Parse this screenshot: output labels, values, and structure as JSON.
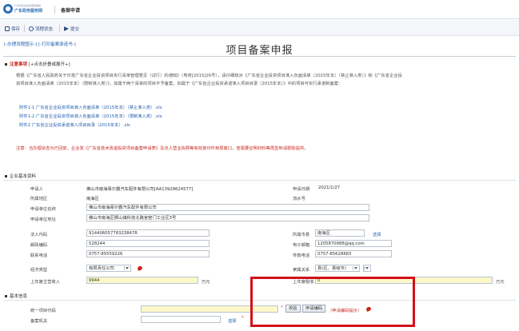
{
  "header": {
    "logo_small": "广东省企业投资项目备案",
    "logo_text": "广东政务服务网",
    "title": "备案申请"
  },
  "toolbar": {
    "save": "保存",
    "process_status": "流程状态",
    "submit": "提交"
  },
  "breadlinks": "[-办理流程图示-] [-打印备案承诺书-]",
  "page_title": "项目备案申报",
  "notice": {
    "heading": "注意事项",
    "fold": "[+点击折叠或展开+]",
    "para1": "根据《广东省人民政府关于印发广东省企业投资项目实行清单管理意见（试行）的通知》（粤府[2015]26号），请仔细核对《广东省企业投资项目准入负面清单（2015年本）（禁止准入类）》和《广东省企业投",
    "para2": "资项目准入负面清单（2015年本）（限制准入类）》，如属于两个清单的项目不予备案，如属于《广东省企业投资承诺准入项目目录（2015年本）》中的项目可实行承诺制备案：",
    "attachments": [
      "附件1-1 广东省企业投资项目准入负面清单（2015年本）（禁止准入类）.xls",
      "附件1-2 广东省企业投资项目准入负面清单（2015年本）（限制准入类）.xls",
      "附件2 广东省企业投资承诺准入项目目录（2015年本）.xls"
    ],
    "warning": "注意：当办理状态为已回复、企业发《广东省技术改造投资项目备案申请表》及法人营业执照等有效复印件到局窗口，若需要证明材料等再签到请帮助提供。"
  },
  "company_section": {
    "heading": "企业基本资料",
    "applicant_label": "申请人",
    "applicant_value": "佛山市南海易尔霸汽车配件有限公司[AA13928624577]",
    "apply_date_label": "申请日期",
    "apply_date_value": "2021/1/27",
    "region_label": "所属地区",
    "region_value": "南海区",
    "serial_label": "流水号",
    "serial_value": "",
    "unit_name_label": "申请单位名称",
    "unit_name_value": "佛山市南海易尔霸汽车配件有限公司",
    "address_label": "申请单位地址",
    "address_value": "佛山市南海区狮山镇科技北路官窑门工业区3号",
    "legal_code_label": "法人代码",
    "legal_code_value": "91440605778323847R",
    "city_label": "所属市县",
    "city_value": "南海区",
    "city_link": "选择",
    "postcode_label": "邮政编码",
    "postcode_value": "528244",
    "email_label": "电子邮箱",
    "email_value": "1205870988@qq.com",
    "phone_label": "联系电话",
    "phone_value": "0757-85559226",
    "fax_label": "传真电话",
    "fax_value": "0757-85628883",
    "econ_type_label": "经济类型",
    "econ_type_value": "有限责任公司",
    "affiliation_label": "隶属关系",
    "affiliation_value": "县(区、县级市)",
    "revenue_label": "上年度主营收入",
    "revenue_value": "9944",
    "revenue_unit": "万元",
    "tax_label": "上年度税收",
    "tax_value": "0",
    "tax_unit": "万元"
  },
  "info_section": {
    "heading": "基本信息",
    "unified_code_label": "统一项目代码",
    "verify_button": "校验",
    "request_code_button": "申请编码",
    "request_code_note": "（申请编码提示）",
    "record_org_label": "备案机关",
    "record_org_link": "选择"
  },
  "colors": {
    "accent": "#2462b0",
    "alert": "#c8291e",
    "highlight": "#d4101a"
  }
}
